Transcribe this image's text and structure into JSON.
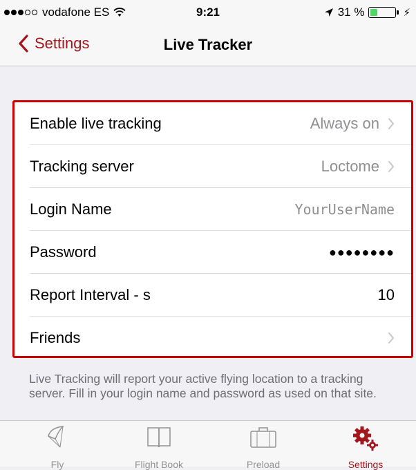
{
  "status_bar": {
    "carrier": "vodafone ES",
    "signal_bars_filled": 3,
    "signal_bars_total": 5,
    "time": "9:21",
    "battery_text": "31 %",
    "battery_level": 0.31,
    "charging_symbol": "⚡"
  },
  "nav": {
    "back_label": "Settings",
    "title": "Live Tracker"
  },
  "settings": {
    "rows": [
      {
        "label": "Enable live tracking",
        "value": "Always on"
      },
      {
        "label": "Tracking server",
        "value": "Loctome"
      },
      {
        "label": "Login Name",
        "value": "YourUserName"
      },
      {
        "label": "Password",
        "value": "●●●●●●●●"
      },
      {
        "label": "Report Interval - s",
        "value": "10"
      },
      {
        "label": "Friends",
        "value": ""
      }
    ]
  },
  "footer_note": "Live Tracking will report your active flying location to a tracking server. Fill in your login name and password as used on that site.",
  "tabs": [
    {
      "label": "Fly",
      "icon": "paraglider-icon"
    },
    {
      "label": "Flight Book",
      "icon": "book-icon"
    },
    {
      "label": "Preload",
      "icon": "suitcase-icon"
    },
    {
      "label": "Settings",
      "icon": "gears-icon"
    }
  ],
  "colors": {
    "accent": "#a3161b",
    "highlight_border": "#cc0000",
    "background": "#efeff4",
    "secondary_text": "#8e8e93",
    "battery": "#4cd964"
  }
}
